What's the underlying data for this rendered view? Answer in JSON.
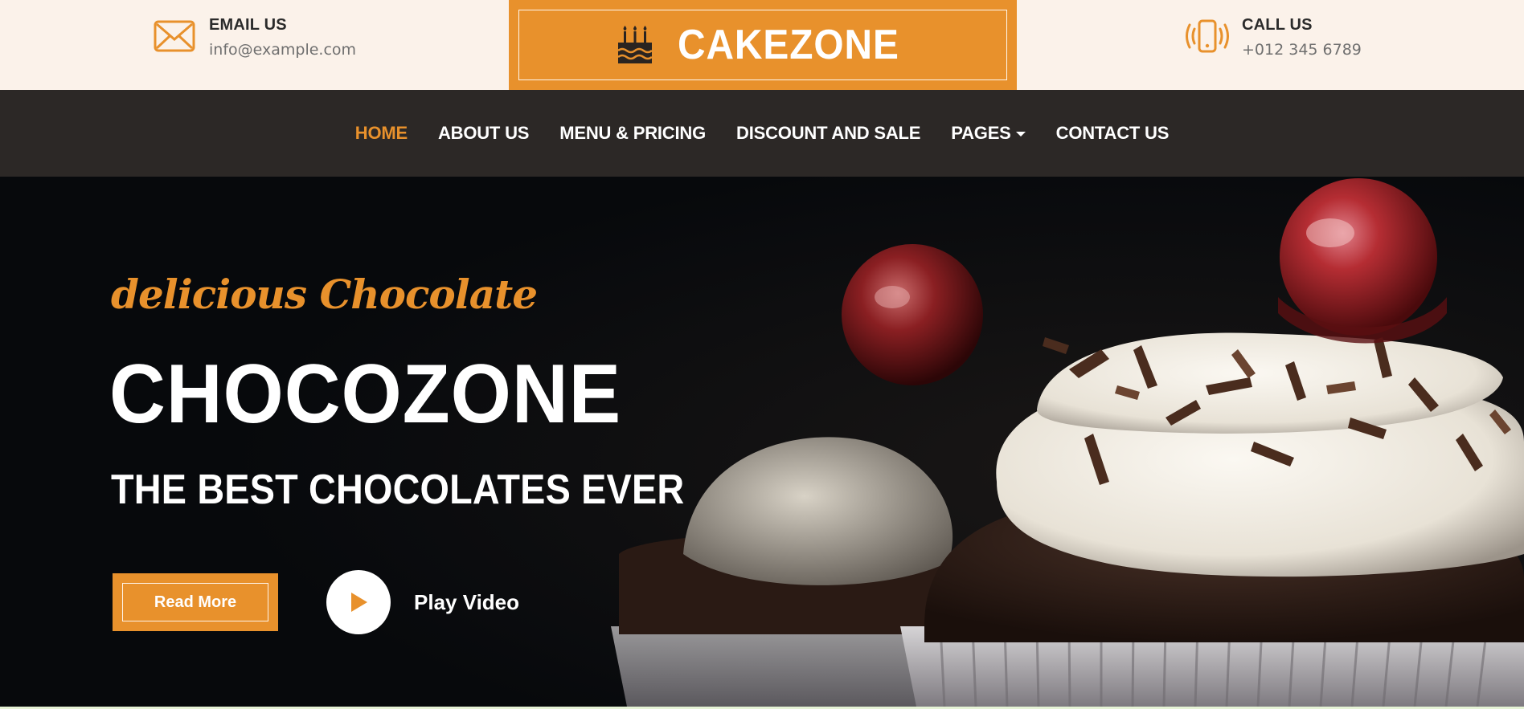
{
  "colors": {
    "accent": "#e8912c",
    "nav_bg": "#2c2826",
    "topbar_bg": "#fbf2ea",
    "hero_bg": "#07090c"
  },
  "topbar": {
    "email": {
      "title": "EMAIL US",
      "value": "info@example.com",
      "icon": "envelope-icon"
    },
    "call": {
      "title": "CALL US",
      "value": "+012 345 6789",
      "icon": "phone-icon"
    },
    "logo": {
      "text": "CAKEZONE",
      "icon": "cake-icon"
    }
  },
  "nav": {
    "items": [
      {
        "label": "HOME",
        "active": true
      },
      {
        "label": "ABOUT US"
      },
      {
        "label": "MENU & PRICING"
      },
      {
        "label": "DISCOUNT AND SALE"
      },
      {
        "label": "PAGES",
        "dropdown": true
      },
      {
        "label": "CONTACT US"
      }
    ]
  },
  "hero": {
    "kicker": "delicious Chocolate",
    "headline": "CHOCOZONE",
    "subline": "THE BEST CHOCOLATES EVER",
    "read_more": "Read More",
    "play_label": "Play Video",
    "play_icon": "play-icon"
  }
}
